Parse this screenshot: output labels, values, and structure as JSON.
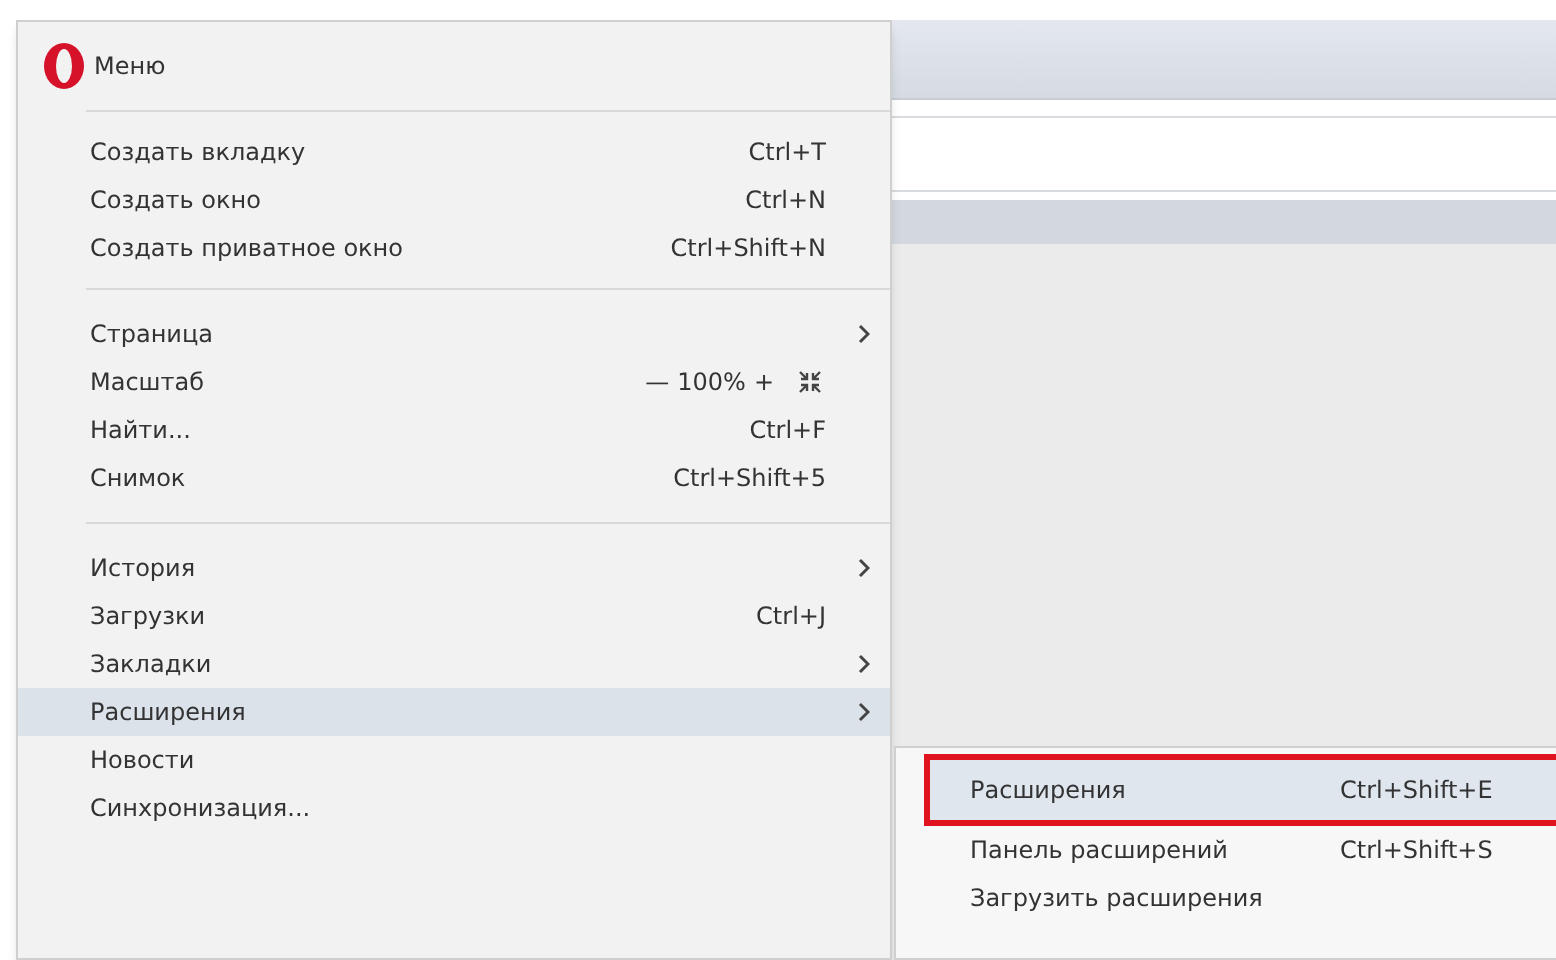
{
  "menu": {
    "title": "Меню",
    "groups": [
      {
        "items": [
          {
            "kind": "normal",
            "label": "Создать вкладку",
            "shortcut": "Ctrl+T",
            "submenu": false,
            "selected": false
          },
          {
            "kind": "normal",
            "label": "Создать окно",
            "shortcut": "Ctrl+N",
            "submenu": false,
            "selected": false
          },
          {
            "kind": "normal",
            "label": "Создать приватное окно",
            "shortcut": "Ctrl+Shift+N",
            "submenu": false,
            "selected": false
          }
        ]
      },
      {
        "items": [
          {
            "kind": "normal",
            "label": "Страница",
            "submenu": true,
            "selected": false
          },
          {
            "kind": "zoom",
            "label": "Масштаб",
            "minus": "—",
            "value": "100%",
            "plus": "+",
            "selected": false
          },
          {
            "kind": "normal",
            "label": "Найти...",
            "shortcut": "Ctrl+F",
            "submenu": false,
            "selected": false
          },
          {
            "kind": "normal",
            "label": "Снимок",
            "shortcut": "Ctrl+Shift+5",
            "submenu": false,
            "selected": false
          }
        ]
      },
      {
        "items": [
          {
            "kind": "normal",
            "label": "История",
            "submenu": true,
            "selected": false
          },
          {
            "kind": "normal",
            "label": "Загрузки",
            "shortcut": "Ctrl+J",
            "submenu": false,
            "selected": false
          },
          {
            "kind": "normal",
            "label": "Закладки",
            "submenu": true,
            "selected": false
          },
          {
            "kind": "normal",
            "label": "Расширения",
            "submenu": true,
            "selected": true
          },
          {
            "kind": "normal",
            "label": "Новости",
            "submenu": false,
            "selected": false
          },
          {
            "kind": "normal",
            "label": "Синхронизация...",
            "submenu": false,
            "selected": false
          }
        ]
      }
    ]
  },
  "submenu": {
    "items": [
      {
        "label": "Расширения",
        "shortcut": "Ctrl+Shift+E",
        "selected": true,
        "outlined": true
      },
      {
        "label": "Панель расширений",
        "shortcut": "Ctrl+Shift+S",
        "selected": false,
        "outlined": false
      },
      {
        "label": "Загрузить расширения",
        "selected": false,
        "outlined": false
      }
    ]
  }
}
